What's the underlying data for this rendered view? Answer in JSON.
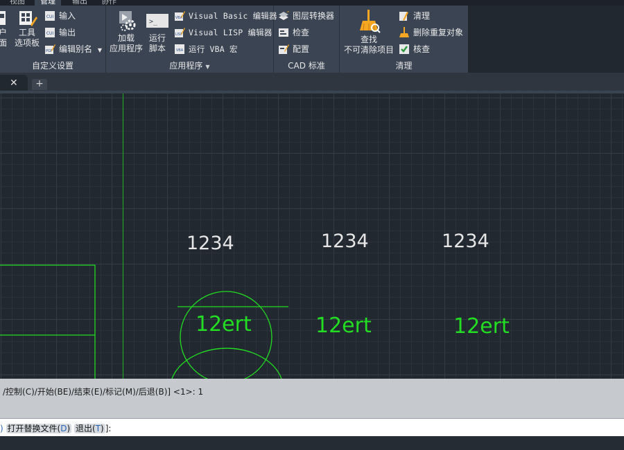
{
  "ribbon": {
    "tabs": [
      "视图",
      "管理",
      "输出",
      "协作"
    ],
    "customize": {
      "title": "自定义设置",
      "user_interface_partial": [
        "户",
        "面"
      ],
      "tool_palettes": [
        "工具",
        "选项板"
      ],
      "import_label": "输入",
      "export_label": "输出",
      "edit_aliases_label": "编辑别名"
    },
    "applications": {
      "title": "应用程序",
      "load_app": [
        "加载",
        "应用程序"
      ],
      "run_script": [
        "运行",
        "脚本"
      ],
      "vb_editor": "Visual Basic 编辑器",
      "lisp_editor": "Visual LISP 编辑器",
      "run_vba": "运行 VBA 宏"
    },
    "cad_standards": {
      "title": "CAD 标准",
      "layer_translator": "图层转换器",
      "check": "检查",
      "configure": "配置"
    },
    "cleanup": {
      "title": "清理",
      "find_non_purgeable": [
        "查找",
        "不可清除项目"
      ],
      "purge": "清理",
      "overkill": "删除重复对象",
      "audit": "核查"
    }
  },
  "drawing": {
    "texts_white": [
      "1234",
      "1234",
      "1234"
    ],
    "texts_green": [
      "12ert",
      "12ert",
      "12ert"
    ]
  },
  "command": {
    "history_line": "/控制(C)/开始(BE)/结束(E)/标记(M)/后退(B)] <1>: 1",
    "prompt_options": [
      {
        "label": "打开替换文件",
        "key": "D"
      },
      {
        "label": "退出",
        "key": "T"
      }
    ],
    "prompt_tail": "]:"
  },
  "colors": {
    "ribbon_bg": "#3b4453",
    "canvas_bg": "#212830",
    "grid_minor": "#2a313b",
    "grid_major": "#343c48",
    "green": "#22dd22",
    "white_text": "#e6e6e6"
  }
}
